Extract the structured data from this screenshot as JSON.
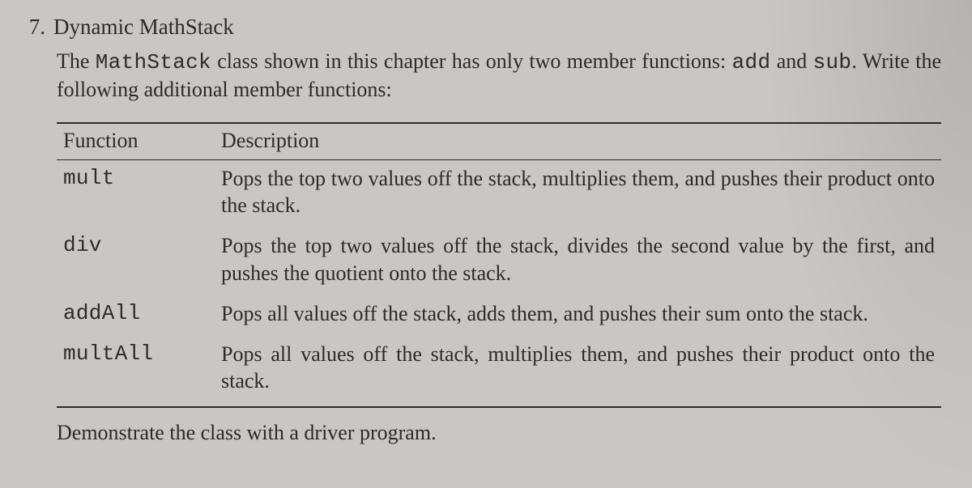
{
  "question_number": "7.",
  "title": "Dynamic MathStack",
  "intro_prefix": "The ",
  "intro_code": "MathStack",
  "intro_mid": " class shown in this chapter has only two member functions: ",
  "intro_code2": "add",
  "intro_and": " and ",
  "intro_code3": "sub",
  "intro_suffix": ". Write the following additional member functions:",
  "col_func": "Function",
  "col_desc": "Description",
  "rows": [
    {
      "fn": "mult",
      "desc": "Pops the top two values off the stack, multiplies them, and pushes their product onto the stack."
    },
    {
      "fn": "div",
      "desc": "Pops the top two values off the stack, divides the second value by the first, and pushes the quotient onto the stack."
    },
    {
      "fn": "addAll",
      "desc": "Pops all values off the stack, adds them, and pushes their sum onto the stack."
    },
    {
      "fn": "multAll",
      "desc": "Pops all values off the stack, multiplies them, and pushes their prod­uct onto the stack."
    }
  ],
  "closing": "Demonstrate the class with a driver program."
}
